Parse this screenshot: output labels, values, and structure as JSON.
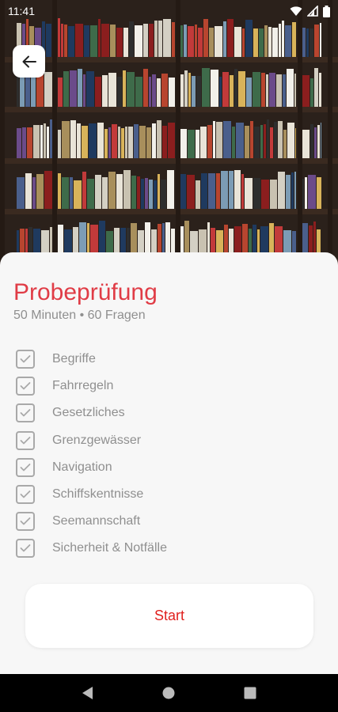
{
  "status_bar": {
    "time": "11:41",
    "icons": [
      "wifi-icon",
      "signal-icon",
      "battery-icon"
    ]
  },
  "header": {
    "back_icon": "arrow-left-icon",
    "image": "bookshelf-photo"
  },
  "exam": {
    "title": "Probeprüfung",
    "subtitle": "50 Minuten • 60 Fragen"
  },
  "topics": [
    {
      "label": "Begriffe",
      "checked": true
    },
    {
      "label": "Fahrregeln",
      "checked": true
    },
    {
      "label": "Gesetzliches",
      "checked": true
    },
    {
      "label": "Grenzgewässer",
      "checked": true
    },
    {
      "label": "Navigation",
      "checked": true
    },
    {
      "label": "Schiffskentnisse",
      "checked": true
    },
    {
      "label": "Seemannschaft",
      "checked": true
    },
    {
      "label": "Sicherheit & Notfälle",
      "checked": true
    }
  ],
  "actions": {
    "start_label": "Start"
  },
  "navbar": {
    "buttons": [
      "back-triangle-icon",
      "home-circle-icon",
      "recents-square-icon"
    ]
  },
  "colors": {
    "accent_title": "#e03c46",
    "accent_button_text": "#e0201e",
    "muted_text": "#8f8f8f",
    "sheet_background": "#f7f7f7"
  }
}
